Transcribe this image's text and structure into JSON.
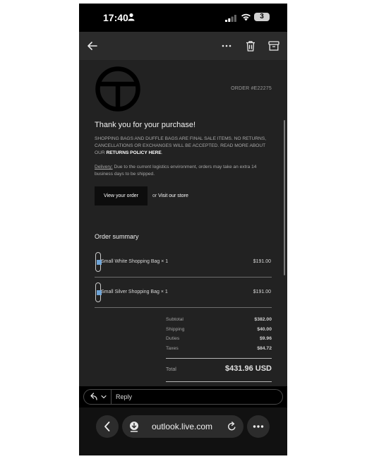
{
  "status_bar": {
    "time": "17:40",
    "battery": "3"
  },
  "toolbar": {
    "back_icon": "arrow-left-icon",
    "more_icon": "ellipsis-icon",
    "delete_icon": "trash-icon",
    "archive_icon": "archive-icon"
  },
  "email": {
    "order_number": "ORDER #E22275",
    "heading": "Thank you for your purchase!",
    "policy_text": "SHOPPING BAGS AND DUFFLE BAGS ARE FINAL SALE ITEMS. NO RETURNS, CANCELLATIONS OR EXCHANGES WILL BE ACCEPTED. READ MORE ABOUT OUR ",
    "policy_link": "RETURNS POLICY HERE",
    "policy_end": ".",
    "delivery_label": "Delivery:",
    "delivery_text": " Due to the current logistics environment, orders may take an extra 14 business days to be shipped.",
    "view_order_label": "View your order",
    "or_text": "or ",
    "visit_store_label": "Visit our store",
    "order_summary_heading": "Order summary",
    "items": [
      {
        "name": "Small White Shopping Bag × 1",
        "price": "$191.00"
      },
      {
        "name": "Small Silver Shopping Bag × 1",
        "price": "$191.00"
      }
    ],
    "summary": {
      "subtotal_label": "Subtotal",
      "subtotal": "$382.00",
      "shipping_label": "Shipping",
      "shipping": "$40.00",
      "duties_label": "Duties",
      "duties": "$9.96",
      "taxes_label": "Taxes",
      "taxes": "$84.72",
      "total_label": "Total",
      "total": "$431.96 USD"
    }
  },
  "reply": {
    "label": "Reply"
  },
  "browser": {
    "url": "outlook.live.com"
  },
  "colors": {
    "toolbar_bg": "#2b2b2b",
    "email_bg": "#222222",
    "accent_white": "#ffffff"
  }
}
